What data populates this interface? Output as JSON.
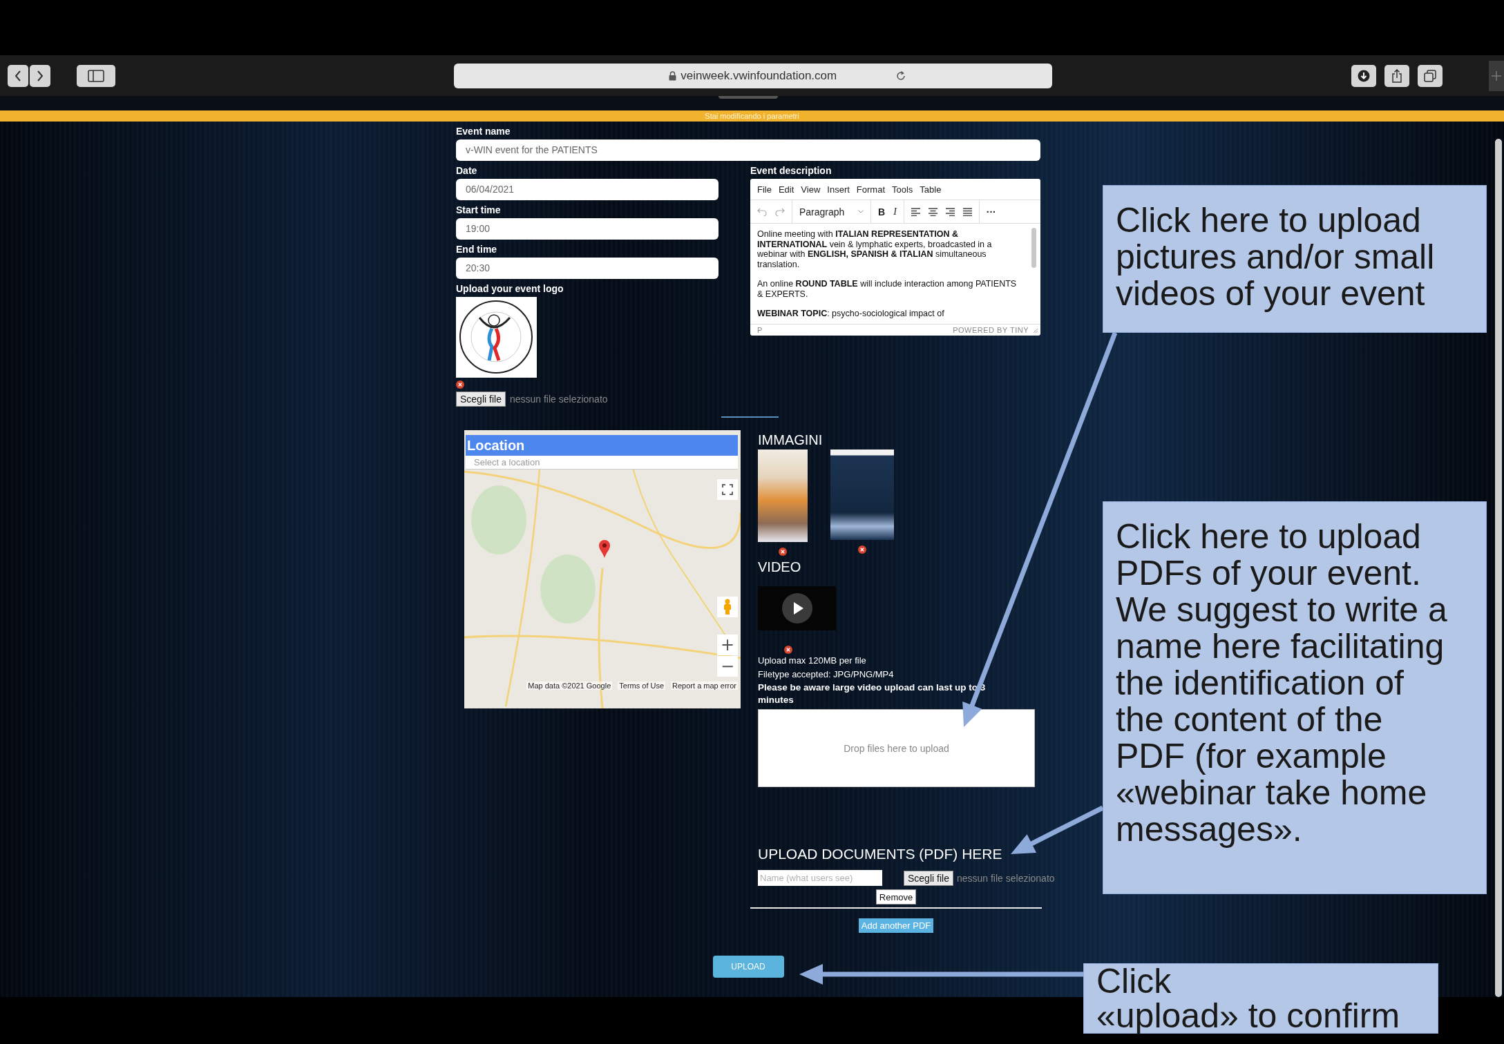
{
  "browser": {
    "url": "veinweek.vwinfoundation.com"
  },
  "banner": "Stai modificando i parametri",
  "form": {
    "event_name": {
      "label": "Event name",
      "value": "v-WIN event for the PATIENTS"
    },
    "date": {
      "label": "Date",
      "value": "06/04/2021"
    },
    "start_time": {
      "label": "Start time",
      "value": "19:00"
    },
    "end_time": {
      "label": "End time",
      "value": "20:30"
    },
    "logo": {
      "label": "Upload your event logo",
      "file_button": "Scegli file",
      "file_status": "nessun file selezionato"
    },
    "description": {
      "label": "Event description",
      "menu": [
        "File",
        "Edit",
        "View",
        "Insert",
        "Format",
        "Tools",
        "Table"
      ],
      "format": "Paragraph",
      "bold": "B",
      "italic": "I",
      "more": "···",
      "paragraphs": [
        "Online meeting with **ITALIAN REPRESENTATION &** **INTERNATIONAL** vein & lymphatic experts, broadcasted in a webinar with **ENGLISH, SPANISH & ITALIAN** simultaneous translation.",
        "An online **ROUND TABLE** will include interaction among PATIENTS & EXPERTS.",
        "**WEBINAR TOPIC**: psycho-sociological impact of"
      ],
      "status_path": "P",
      "branding": "POWERED BY TINY"
    }
  },
  "map": {
    "title": "Location",
    "placeholder": "Select a location",
    "zoom_in": "+",
    "zoom_out": "−",
    "footer": [
      "Map data ©2021 Google",
      "Terms of Use",
      "Report a map error"
    ]
  },
  "media": {
    "images_heading": "IMMAGINI",
    "images": [
      {
        "kind": "light-poster"
      },
      {
        "kind": "dark-poster"
      }
    ],
    "video_heading": "VIDEO",
    "videos": [
      {
        "kind": "clip"
      }
    ],
    "notes": [
      "Upload max 120MB per file",
      "Filetype accepted: JPG/PNG/MP4"
    ],
    "warning": "Please be aware large video upload can last up to 3 minutes",
    "dropzone": "Drop files here to upload"
  },
  "documents": {
    "heading": "UPLOAD DOCUMENTS (PDF) HERE",
    "rows": [
      {
        "name_placeholder": "Name (what users see)",
        "file_button": "Scegli file",
        "file_status": "nessun file selezionato",
        "remove": "Remove"
      }
    ],
    "add": "Add another PDF"
  },
  "submit": "UPLOAD",
  "callouts": [
    {
      "text": "Click here to upload\npictures and/or small\nvideos of your event"
    },
    {
      "text": "Click here to upload\nPDFs  of your event.\nWe suggest to write a\nname here facilitating\nthe identification of\nthe content of the\nPDF (for example\n«webinar take home\nmessages»."
    },
    {
      "text": "Click\n«upload» to confirm"
    }
  ]
}
